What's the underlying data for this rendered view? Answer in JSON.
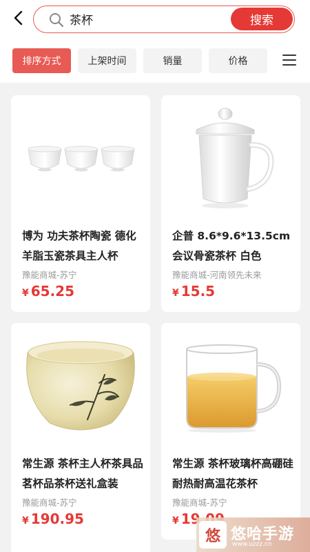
{
  "search": {
    "query": "茶杯",
    "button_label": "搜索"
  },
  "sort": {
    "chips": [
      "排序方式",
      "上架时间",
      "销量",
      "价格"
    ],
    "active_index": 0
  },
  "products": [
    {
      "title": "博为 功夫茶杯陶瓷 德化羊脂玉瓷茶具主人杯",
      "store": "豫能商城-苏宁",
      "currency": "¥",
      "price": "65.25",
      "image": "white-porcelain-cups"
    },
    {
      "title": "企普 8.6*9.6*13.5cm 会议骨瓷茶杯 白色",
      "store": "豫能商城-河南领先未来",
      "currency": "¥",
      "price": "15.5",
      "image": "lidded-mug"
    },
    {
      "title": "常生源 茶杯主人杯茶具品茗杯品茶杯送礼盒装",
      "store": "豫能商城-苏宁",
      "currency": "¥",
      "price": "190.95",
      "image": "bamboo-jade-cup"
    },
    {
      "title": "常生源 茶杯玻璃杯高硼硅耐热耐高温花茶杯",
      "store": "豫能商城-苏宁",
      "currency": "¥",
      "price": "19.09",
      "image": "glass-tea-mug"
    }
  ],
  "watermark": {
    "logo": "悠",
    "text": "悠哈手游",
    "sub": "www.uzzz.cn"
  },
  "colors": {
    "accent": "#e53935",
    "chip_active": "#e85a54",
    "price": "#e53935"
  }
}
